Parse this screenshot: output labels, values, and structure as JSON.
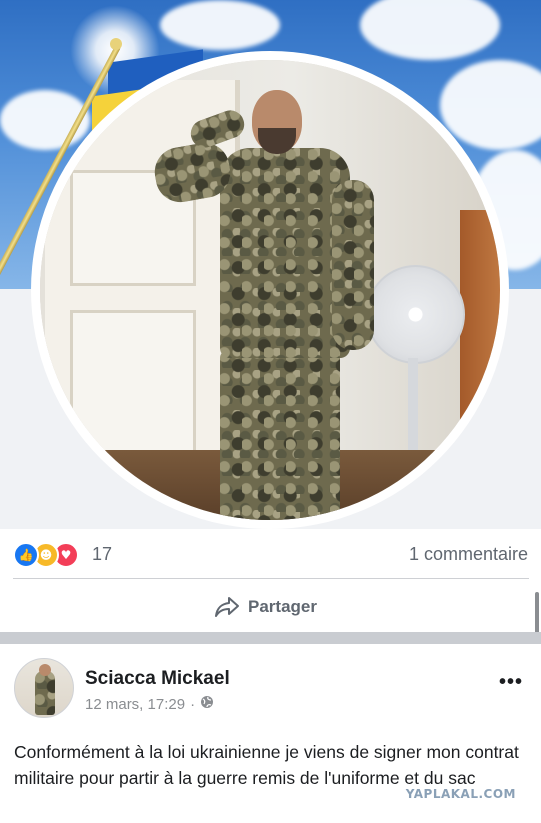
{
  "reactions": {
    "count": "17",
    "comments_label": "1 commentaire",
    "icons": [
      "like-icon",
      "care-icon",
      "love-icon"
    ]
  },
  "actions": {
    "share_label": "Partager"
  },
  "post": {
    "author": "Sciacca Mickael",
    "date": "12 mars, 17:29",
    "separator": "·",
    "more": "•••",
    "text": "Conformément à la loi ukrainienne je viens de signer mon contrat militaire pour partir à la guerre remis de l'uniforme et du sac"
  },
  "watermark": "YAPLAKAL.COM",
  "colors": {
    "like": "#1877f2",
    "care": "#f7b928",
    "love": "#f33e58",
    "secondary_text": "#606770"
  }
}
